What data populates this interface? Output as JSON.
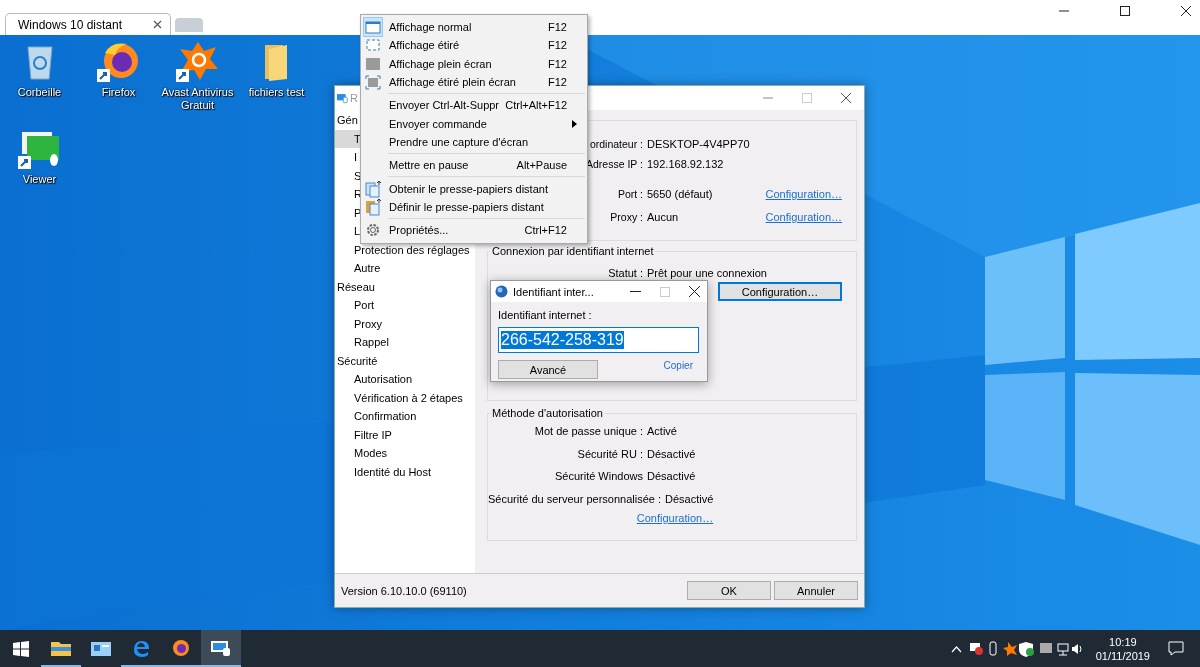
{
  "browser": {
    "tabs": [
      {
        "title": "Windows 10 distant",
        "selected": true
      }
    ]
  },
  "desktop_icons": [
    {
      "kind": "bin",
      "label": "Corbeille",
      "shortcut": false
    },
    {
      "kind": "firefox",
      "label": "Firefox",
      "shortcut": true
    },
    {
      "kind": "avast",
      "label": "Avast Antivirus Gratuit",
      "shortcut": true
    },
    {
      "kind": "folder",
      "label": "fichiers test",
      "shortcut": false
    },
    {
      "kind": "viewer",
      "label": "Viewer",
      "shortcut": true
    }
  ],
  "settings": {
    "title": "R",
    "sidebar": [
      {
        "label": "Gén",
        "selected": false,
        "children": [
          {
            "label": "T",
            "selected": true
          },
          {
            "label": "I",
            "selected": false
          },
          {
            "label": "S",
            "selected": false
          },
          {
            "label": "R",
            "selected": false
          },
          {
            "label": "P",
            "selected": false
          },
          {
            "label": "L",
            "selected": false
          },
          {
            "label": "Protection des réglages",
            "selected": false
          },
          {
            "label": "Autre",
            "selected": false
          }
        ]
      },
      {
        "label": "Réseau",
        "selected": false,
        "children": [
          {
            "label": "Port",
            "selected": false
          },
          {
            "label": "Proxy",
            "selected": false
          },
          {
            "label": "Rappel",
            "selected": false
          }
        ]
      },
      {
        "label": "Sécurité",
        "selected": false,
        "children": [
          {
            "label": "Autorisation",
            "selected": false
          },
          {
            "label": "Vérification à 2 étapes",
            "selected": false
          },
          {
            "label": "Confirmation",
            "selected": false
          },
          {
            "label": "Filtre IP",
            "selected": false
          },
          {
            "label": "Modes",
            "selected": false
          },
          {
            "label": "Identité du Host",
            "selected": false
          }
        ]
      }
    ],
    "computer": {
      "rows": [
        {
          "label": "ordinateur :",
          "value": "DESKTOP-4V4PP70"
        },
        {
          "label": "Adresse IP :",
          "value": "192.168.92.132"
        },
        {
          "label": "Port :",
          "value": "5650 (défaut)",
          "link": "Configuration…"
        },
        {
          "label": "Proxy :",
          "value": "Aucun",
          "link": "Configuration…"
        }
      ]
    },
    "internet": {
      "legend": "Connexion par identifiant internet",
      "rows": [
        {
          "label": "Statut :",
          "value": "Prêt pour une connexion"
        }
      ],
      "button": {
        "label": "Configuration…",
        "focused": true
      }
    },
    "authorization": {
      "legend": "Méthode d'autorisation",
      "rows": [
        {
          "label": "Mot de passe unique :",
          "value": "Activé"
        },
        {
          "label": "Sécurité RU :",
          "value": "Désactivé"
        },
        {
          "label": "Sécurité Windows",
          "value": "Désactivé"
        },
        {
          "label": "Sécurité du serveur personnalisée :",
          "value": "Désactivé"
        }
      ],
      "link": "Configuration…"
    },
    "version": "Version 6.10.10.0 (69110)",
    "buttons": [
      "OK",
      "Annuler"
    ]
  },
  "context_menu": [
    {
      "kind": "window",
      "label": "Affichage normal",
      "shortcut": "F12",
      "checked": true
    },
    {
      "kind": "stretch",
      "label": "Affichage étiré",
      "shortcut": "F12",
      "checked": false
    },
    {
      "kind": "fullscreen",
      "label": "Affichage plein écran",
      "shortcut": "F12",
      "checked": false
    },
    {
      "kind": "fullstretch",
      "label": "Affichage étiré plein écran",
      "shortcut": "F12",
      "checked": false
    },
    {
      "kind": "separator"
    },
    {
      "kind": "text",
      "label": "Envoyer Ctrl-Alt-Suppr",
      "shortcut": "Ctrl+Alt+F12"
    },
    {
      "kind": "text",
      "label": "Envoyer commande",
      "submenu": true
    },
    {
      "kind": "text",
      "label": "Prendre une capture d'écran"
    },
    {
      "kind": "separator"
    },
    {
      "kind": "text",
      "label": "Mettre en pause",
      "shortcut": "Alt+Pause"
    },
    {
      "kind": "separator"
    },
    {
      "kind": "clipget",
      "label": "Obtenir le presse-papiers distant"
    },
    {
      "kind": "clipset",
      "label": "Définir le presse-papiers distant"
    },
    {
      "kind": "separator"
    },
    {
      "kind": "gear",
      "label": "Propriétés...",
      "shortcut": "Ctrl+F12"
    }
  ],
  "dialog": {
    "title": "Identifiant inter...",
    "label": "Identifiant internet :",
    "value": "266-542-258-319",
    "value_selected": true,
    "button": "Avancé",
    "link": "Copier"
  },
  "taskbar": {
    "apps": [
      {
        "kind": "folder",
        "running": true,
        "selected": false
      },
      {
        "kind": "panel",
        "running": false,
        "selected": false
      },
      {
        "kind": "edge",
        "running": true,
        "selected": false
      },
      {
        "kind": "firefox",
        "running": true,
        "selected": false
      },
      {
        "kind": "remote",
        "running": true,
        "selected": true
      }
    ],
    "time": "10:19",
    "date": "01/11/2019"
  }
}
